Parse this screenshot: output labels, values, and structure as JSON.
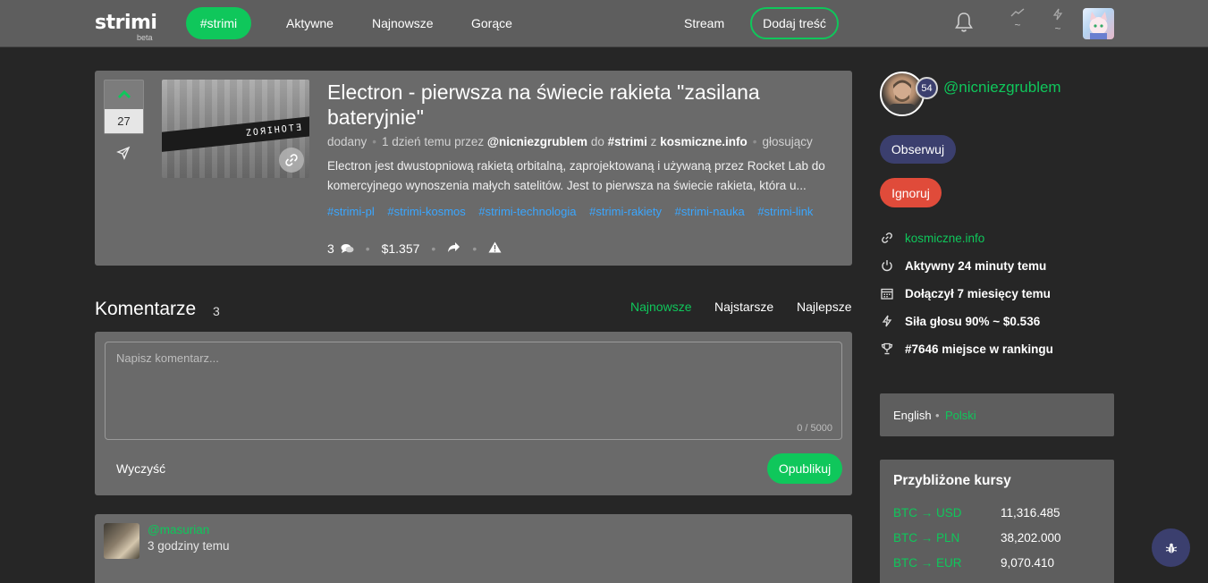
{
  "header": {
    "logo": "strimi",
    "logo_badge": "beta",
    "active_channel": "#strimi",
    "nav": [
      "Aktywne",
      "Najnowsze",
      "Gorące"
    ],
    "stream": "Stream",
    "add_content": "Dodaj treść",
    "stat_placeholder": "~"
  },
  "post": {
    "votes": "27",
    "title": "Electron - pierwsza na świecie rakieta \"zasilana bateryjnie\"",
    "meta": {
      "added": "dodany",
      "time": "1 dzień temu",
      "by_word": "przez",
      "author": "@nicniezgrublem",
      "to_word": "do",
      "channel": "#strimi",
      "from_word": "z",
      "source": "kosmiczne.info",
      "voters": "głosujący"
    },
    "description": "Electron jest dwustopniową rakietą orbitalną, zaprojektowaną i używaną przez Rocket Lab do komercyjnego wynoszenia małych satelitów. Jest to pierwsza na świecie rakieta, która u...",
    "tags": [
      "#strimi-pl",
      "#strimi-kosmos",
      "#strimi-technologia",
      "#strimi-rakiety",
      "#strimi-nauka",
      "#strimi-link"
    ],
    "comments_count": "3",
    "payout": "$1.357",
    "thumb_text": "ZOЯIHOTƎ"
  },
  "comments": {
    "title": "Komentarze",
    "count": "3",
    "sort": [
      "Najnowsze",
      "Najstarsze",
      "Najlepsze"
    ],
    "form": {
      "placeholder": "Napisz komentarz...",
      "counter": "0 / 5000",
      "clear": "Wyczyść",
      "publish": "Opublikuj"
    },
    "items": [
      {
        "user": "@masurian",
        "time": "3 godziny temu"
      }
    ]
  },
  "sidebar": {
    "profile": {
      "name": "@nicniezgrublem",
      "level": "54",
      "follow": "Obserwuj",
      "ignore": "Ignoruj"
    },
    "info": {
      "website": "kosmiczne.info",
      "active": "Aktywny 24 minuty temu",
      "joined": "Dołączył 7 miesięcy temu",
      "vote_power": "Siła głosu 90% ~ $0.536",
      "rank": "#7646 miejsce w rankingu"
    },
    "languages": {
      "en": "English",
      "sep": "•",
      "pl": "Polski"
    },
    "rates": {
      "title": "Przybliżone kursy",
      "rows": [
        {
          "pair": "BTC → USD",
          "value": "11,316.485"
        },
        {
          "pair": "BTC → PLN",
          "value": "38,202.000"
        },
        {
          "pair": "BTC → EUR",
          "value": "9,070.410"
        }
      ]
    }
  },
  "colors": {
    "accent": "#0fc75b",
    "header_bg": "#5e5e5e",
    "page_bg": "#262626",
    "card_bg": "#6a6a6a",
    "tag": "#3aa6ff",
    "danger": "#e04b3a",
    "navy": "#3b3f6e"
  }
}
